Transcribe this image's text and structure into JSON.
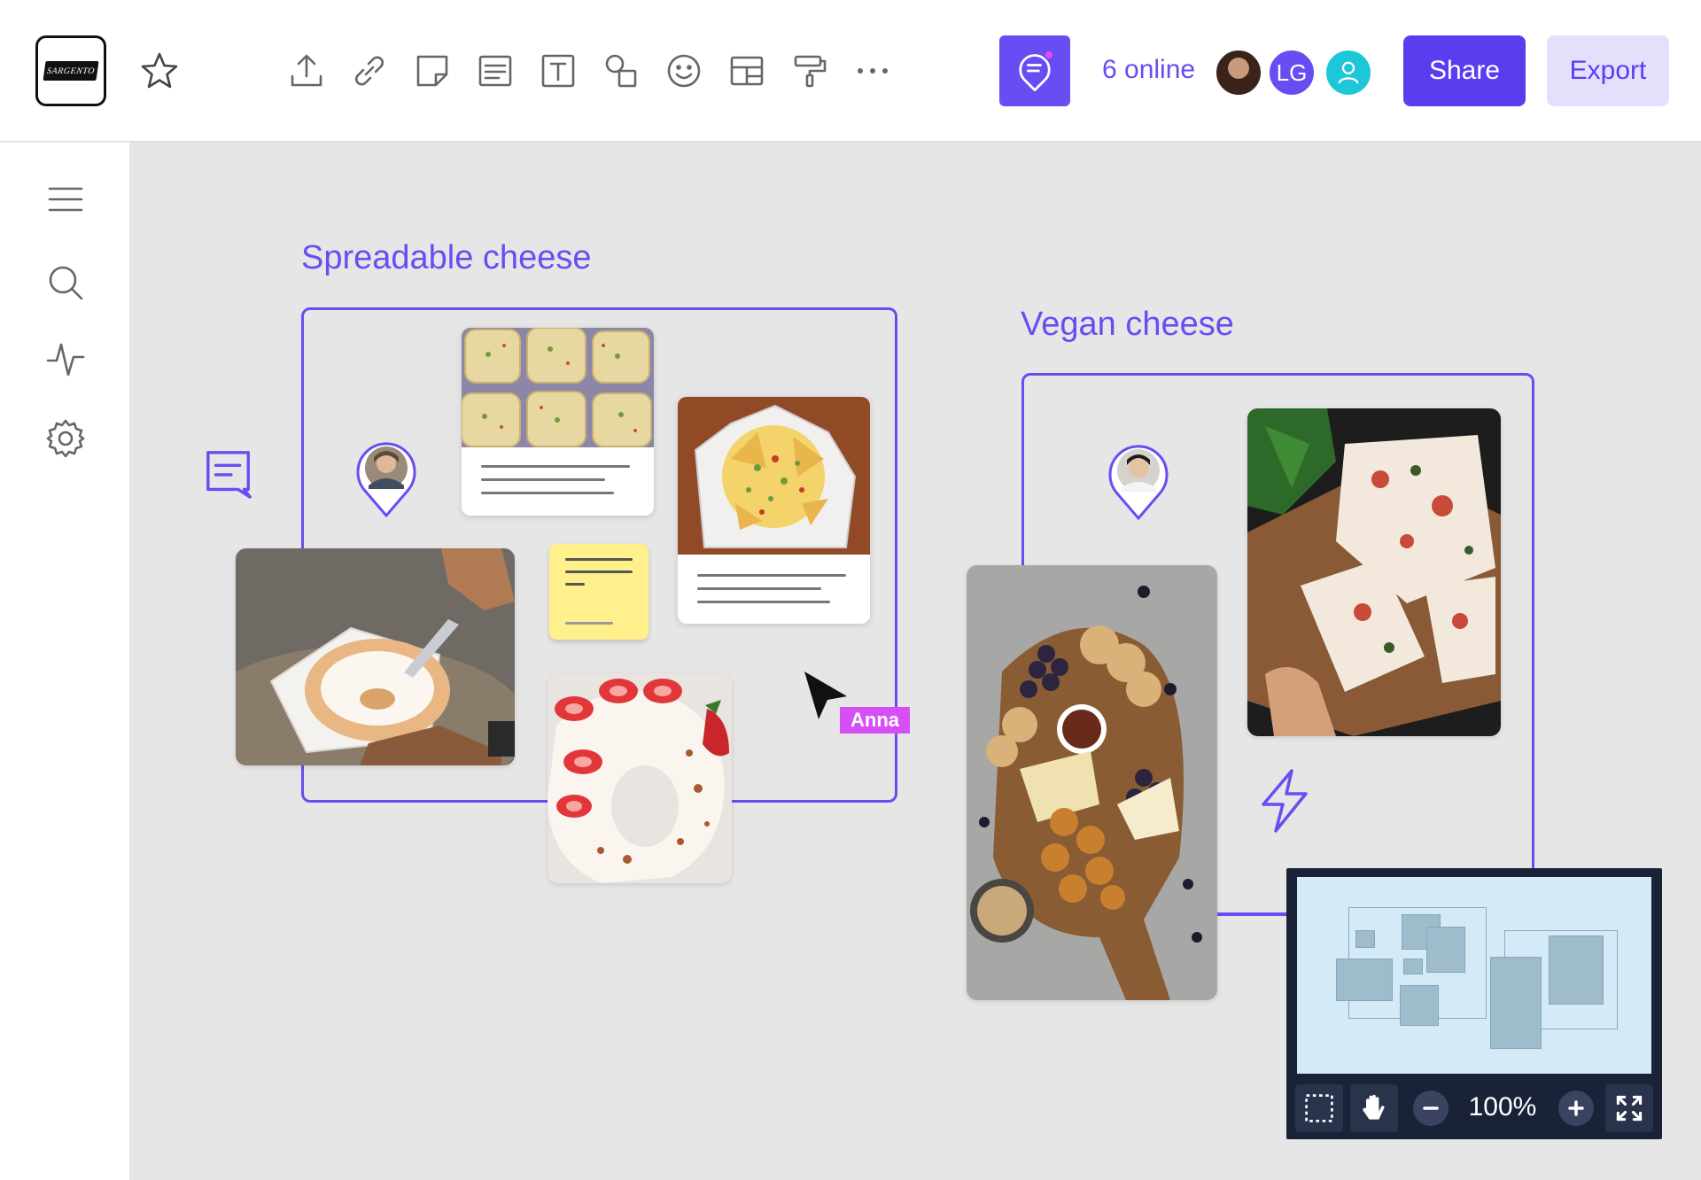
{
  "header": {
    "online_count": "6 online",
    "avatar_initials": "LG",
    "share_label": "Share",
    "export_label": "Export",
    "logo_text": "SARGENTO",
    "tools": [
      "upload-icon",
      "link-icon",
      "sticky-note-icon",
      "card-icon",
      "text-icon",
      "shapes-icon",
      "emoji-icon",
      "table-icon",
      "format-painter-icon",
      "more-icon"
    ]
  },
  "sidebar": {
    "items": [
      "menu-icon",
      "search-icon",
      "activity-icon",
      "settings-icon"
    ]
  },
  "canvas": {
    "frames": [
      {
        "title": "Spreadable cheese"
      },
      {
        "title": "Vegan cheese"
      }
    ],
    "cursor": {
      "user": "Anna"
    }
  },
  "minimap": {
    "zoom": "100%"
  },
  "colors": {
    "accent": "#6a4cf3",
    "cursor_label": "#d64ff5",
    "sticky": "#fff08c",
    "minimap_bg": "#1a2238"
  }
}
